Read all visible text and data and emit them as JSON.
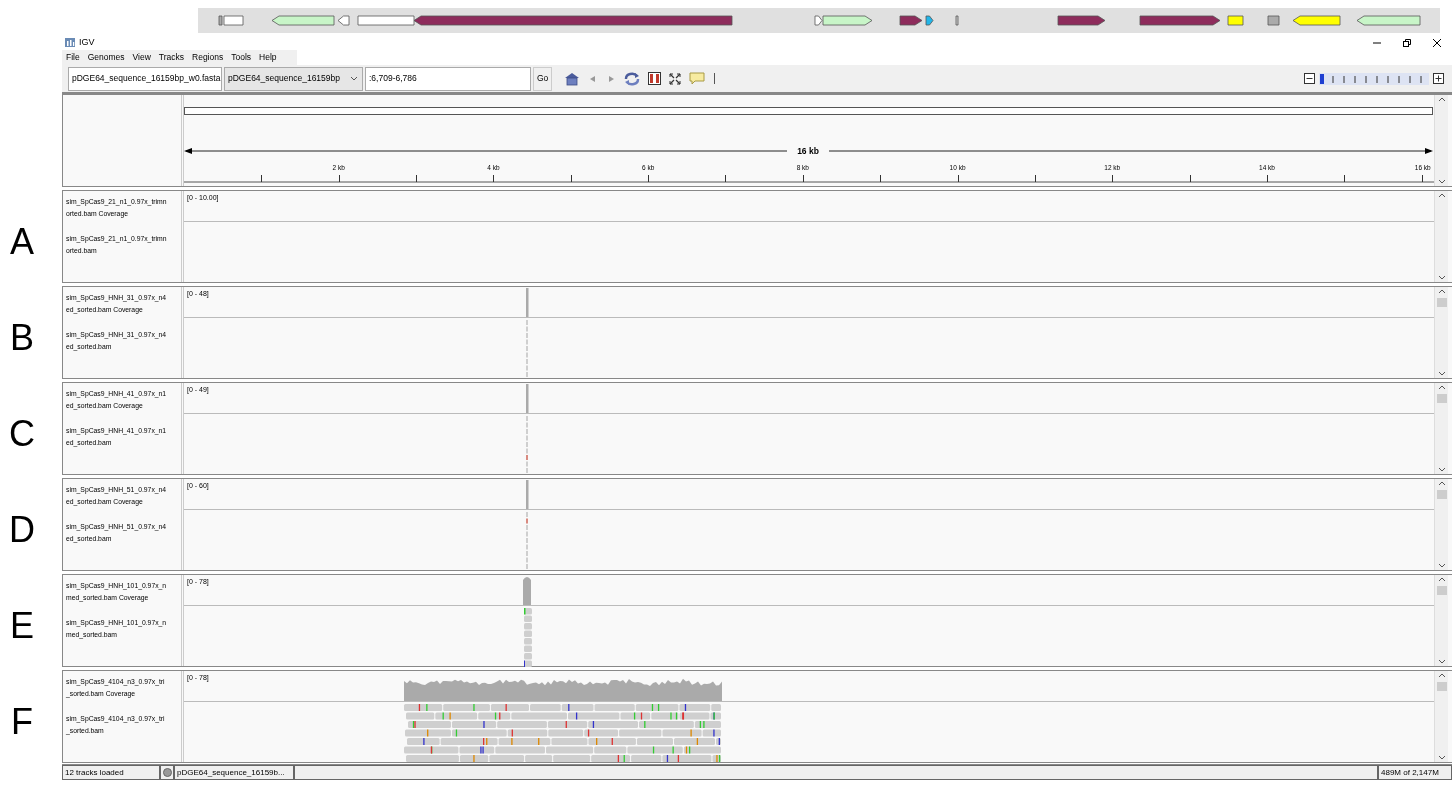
{
  "window": {
    "title": "IGV"
  },
  "menu": [
    {
      "label": "File"
    },
    {
      "label": "Genomes"
    },
    {
      "label": "View"
    },
    {
      "label": "Tracks"
    },
    {
      "label": "Regions"
    },
    {
      "label": "Tools"
    },
    {
      "label": "Help"
    }
  ],
  "toolbar": {
    "genome": "pDGE64_sequence_16159bp_w0.fasta",
    "chromosome": "pDGE64_sequence_16159bp",
    "locus": ":6,709-6,786",
    "go": "Go"
  },
  "zoom": {
    "level": 0
  },
  "ruler": {
    "span": "16 kb",
    "ticks": [
      "2 kb",
      "4 kb",
      "6 kb",
      "8 kb",
      "10 kb",
      "12 kb",
      "14 kb",
      "16 kb"
    ]
  },
  "panels": [
    {
      "letter": "A",
      "kind": "empty",
      "range": "[0 - 10.00]",
      "coverage_label": [
        "sim_SpCas9_21_n1_0.97x_trimn",
        "orted.bam Coverage"
      ],
      "reads_label": [
        "sim_SpCas9_21_n1_0.97x_trimn",
        "orted.bam"
      ]
    },
    {
      "letter": "B",
      "kind": "spike",
      "range": "[0 - 48]",
      "coverage_label": [
        "sim_SpCas9_HNH_31_0.97x_n4",
        "ed_sorted.bam Coverage"
      ],
      "reads_label": [
        "sim_SpCas9_HNH_31_0.97x_n4",
        "ed_sorted.bam"
      ]
    },
    {
      "letter": "C",
      "kind": "spike",
      "range": "[0 - 49]",
      "coverage_label": [
        "sim_SpCas9_HNH_41_0.97x_n1",
        "ed_sorted.bam Coverage"
      ],
      "reads_label": [
        "sim_SpCas9_HNH_41_0.97x_n1",
        "ed_sorted.bam"
      ]
    },
    {
      "letter": "D",
      "kind": "spike",
      "range": "[0 - 60]",
      "coverage_label": [
        "sim_SpCas9_HNH_51_0.97x_n4",
        "ed_sorted.bam Coverage"
      ],
      "reads_label": [
        "sim_SpCas9_HNH_51_0.97x_n4",
        "ed_sorted.bam"
      ]
    },
    {
      "letter": "E",
      "kind": "peak",
      "range": "[0 - 78]",
      "coverage_label": [
        "sim_SpCas9_HNH_101_0.97x_n",
        "med_sorted.bam Coverage"
      ],
      "reads_label": [
        "sim_SpCas9_HNH_101_0.97x_n",
        "med_sorted.bam"
      ]
    },
    {
      "letter": "F",
      "kind": "broad",
      "range": "[0 - 78]",
      "coverage_label": [
        "sim_SpCas9_4104_n3_0.97x_tri",
        "_sorted.bam Coverage"
      ],
      "reads_label": [
        "sim_SpCas9_4104_n3_0.97x_tri",
        "_sorted.bam"
      ]
    }
  ],
  "status_bar": {
    "message": "12 tracks loaded",
    "locus": "pDGE64_sequence_16159b...",
    "memory": "489M of 2,147M"
  }
}
